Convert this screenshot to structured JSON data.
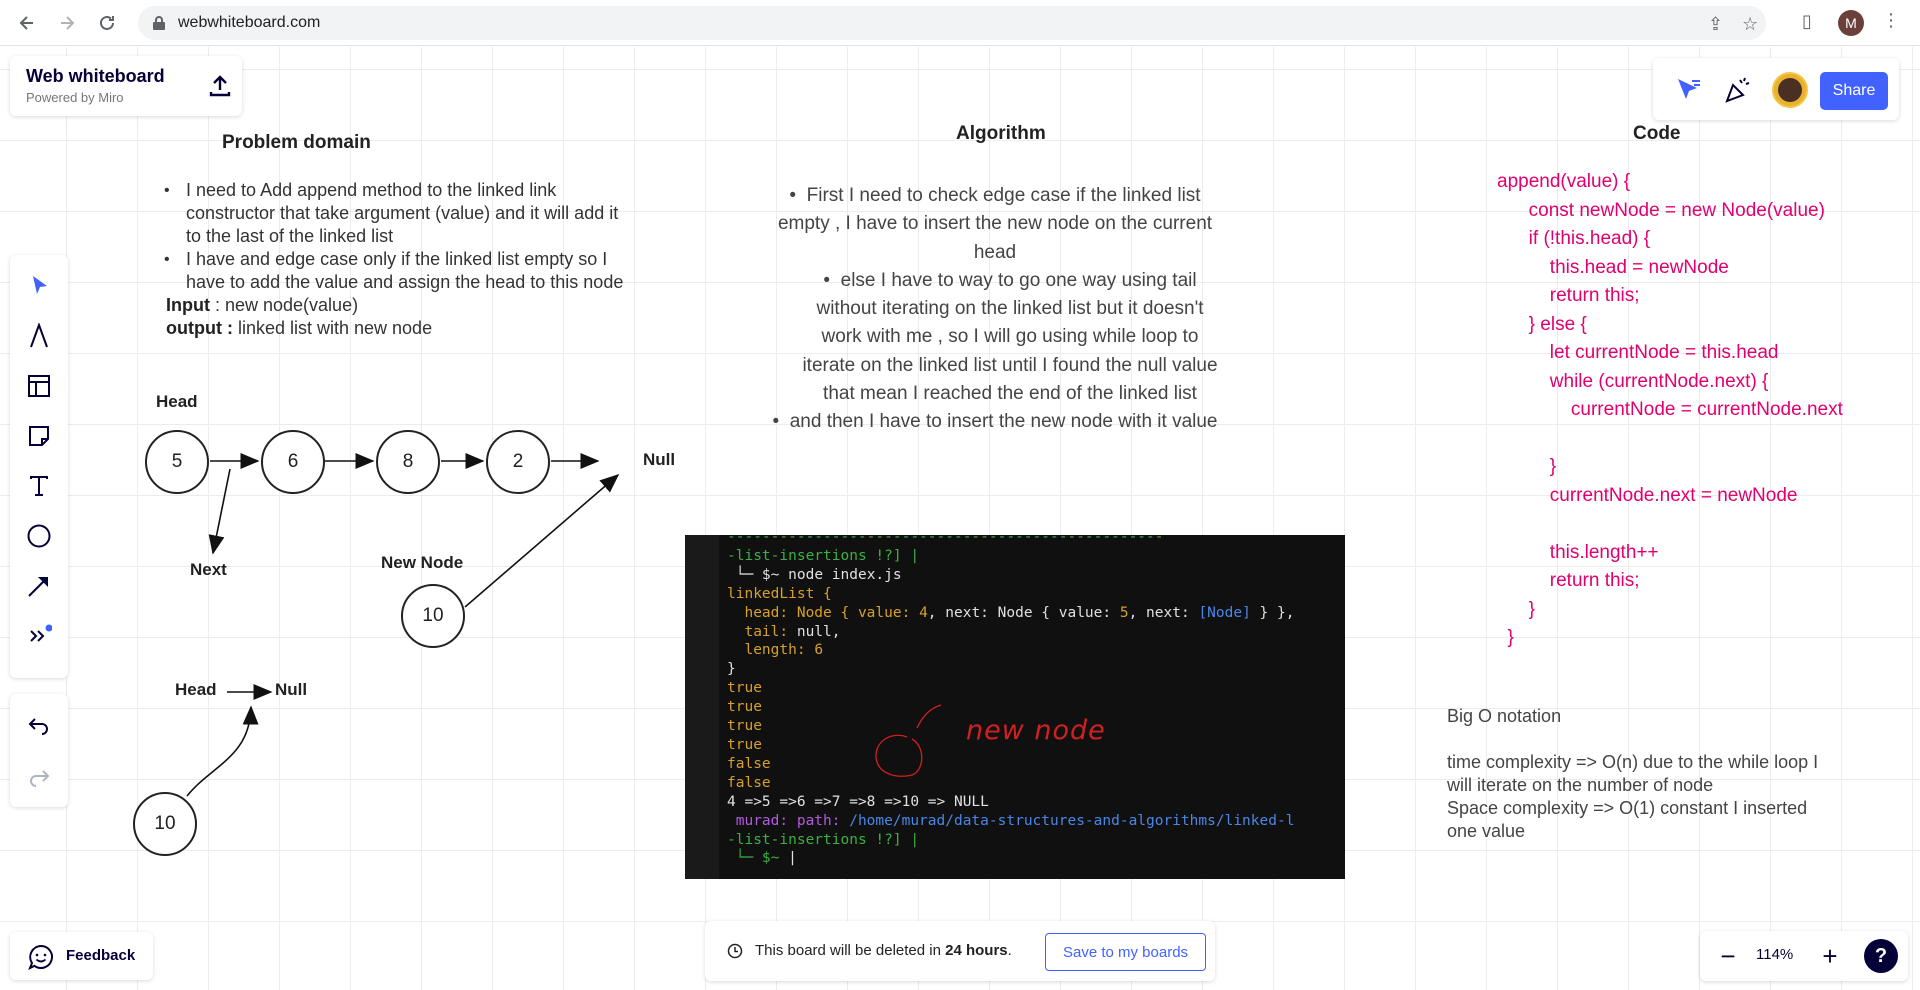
{
  "browser": {
    "url": "webwhiteboard.com",
    "profile_initial": "M"
  },
  "board": {
    "title": "Web whiteboard",
    "subtitle": "Powered by Miro",
    "share_label": "Share"
  },
  "problem": {
    "heading": "Problem domain",
    "bullets": [
      "I need to Add append method to the linked link constructor that take argument (value) and it will add it to the last of the linked list",
      "I have and edge case only if the linked list empty so I have to add the value and assign the head to this node"
    ],
    "input_label": "Input",
    "input_value": "  : new node(value)",
    "output_label": "output :",
    "output_value": " linked list with new node"
  },
  "diagram": {
    "head_label": "Head",
    "nodes": [
      "5",
      "6",
      "8",
      "2"
    ],
    "null_label": "Null",
    "next_label": "Next",
    "new_node_label": "New Node",
    "new_node_value": "10",
    "head2_label": "Head",
    "null2_label": "Null",
    "node2_value": "10"
  },
  "algorithm": {
    "heading": "Algorithm",
    "bullets": [
      "First I need to check edge case if the linked list empty , I have to insert the new node on the current head",
      "else I have to way to go one way using tail without iterating on the linked list  but it doesn't work with me  , so I will go using while loop to iterate on the linked list until I found the null value that mean I reached the end of the linked list",
      "and then I have to insert the new node with it value"
    ]
  },
  "code": {
    "heading": "Code",
    "text": "append(value) {\n      const newNode = new Node(value)\n      if (!this.head) {\n          this.head = newNode\n          return this;\n      } else {\n          let currentNode = this.head\n          while (currentNode.next) {\n              currentNode = currentNode.next\n\n          }\n          currentNode.next = newNode\n\n          this.length++\n          return this;\n      }\n  }"
  },
  "bigo": {
    "title": "Big O notation",
    "time": "time complexity => O(n) due to the while loop I will iterate on the number of node",
    "space": "Space complexity => O(1) constant I inserted one value"
  },
  "terminal": {
    "annotation": "new node",
    "line_prompt_path": "-list-insertions !?] |",
    "line_cmd": "node index.js",
    "line_ll": "linkedList {",
    "line_head_a": "  head: Node { value: ",
    "line_head_v1": "4",
    "line_head_b": ", next: Node { value: ",
    "line_head_v2": "5",
    "line_head_c": ", next: ",
    "line_head_node": "[Node]",
    "line_head_d": " } },",
    "line_tail_a": "  tail: ",
    "line_tail_v": "null",
    "line_tail_b": ",",
    "line_len_a": "  length: ",
    "line_len_v": "6",
    "line_close": "}",
    "bools": [
      "true",
      "true",
      "true",
      "true",
      "false",
      "false"
    ],
    "line_list": "4 =>5 =>6 =>7 =>8 =>10 => NULL",
    "line_user": " murad: path: ",
    "line_path": "/home/murad/data-structures-and-algorithms/linked-l",
    "line_branch": "-list-insertions !?] |",
    "prompt_symbol": "└─ $~"
  },
  "footer": {
    "feedback": "Feedback",
    "notice_pre": "This board will be deleted in ",
    "notice_bold": "24 hours",
    "notice_post": ".",
    "save_label": "Save to my boards",
    "zoom": "114%",
    "help": "?"
  },
  "colors": {
    "accent": "#4262ff",
    "code": "#e0006f"
  }
}
